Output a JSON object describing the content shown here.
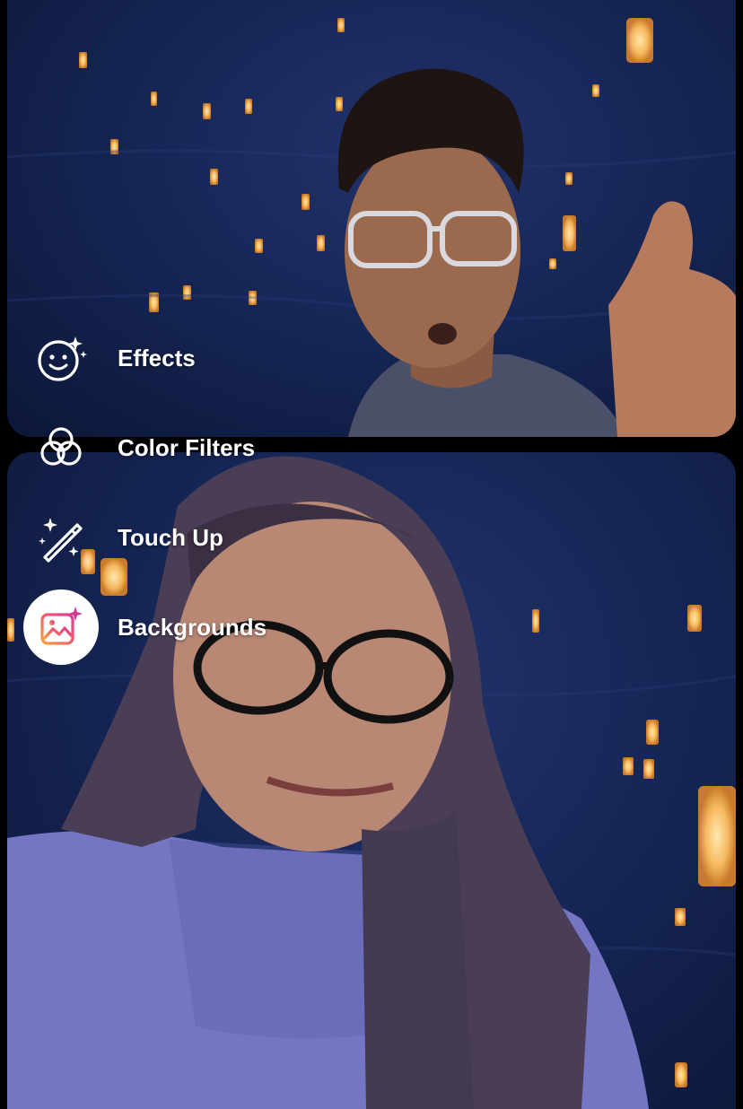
{
  "menu": {
    "items": [
      {
        "label": "Effects",
        "icon": "face-sparkle-icon",
        "selected": false
      },
      {
        "label": "Color Filters",
        "icon": "color-circles-icon",
        "selected": false
      },
      {
        "label": "Touch Up",
        "icon": "magic-wand-icon",
        "selected": false
      },
      {
        "label": "Backgrounds",
        "icon": "image-sparkle-icon",
        "selected": true
      }
    ]
  },
  "colors": {
    "night_sky": "#162656",
    "lantern": "#f5b860",
    "selected_bg": "#ffffff",
    "icon_gradient_start": "#f7a13b",
    "icon_gradient_end": "#d63b9a"
  }
}
